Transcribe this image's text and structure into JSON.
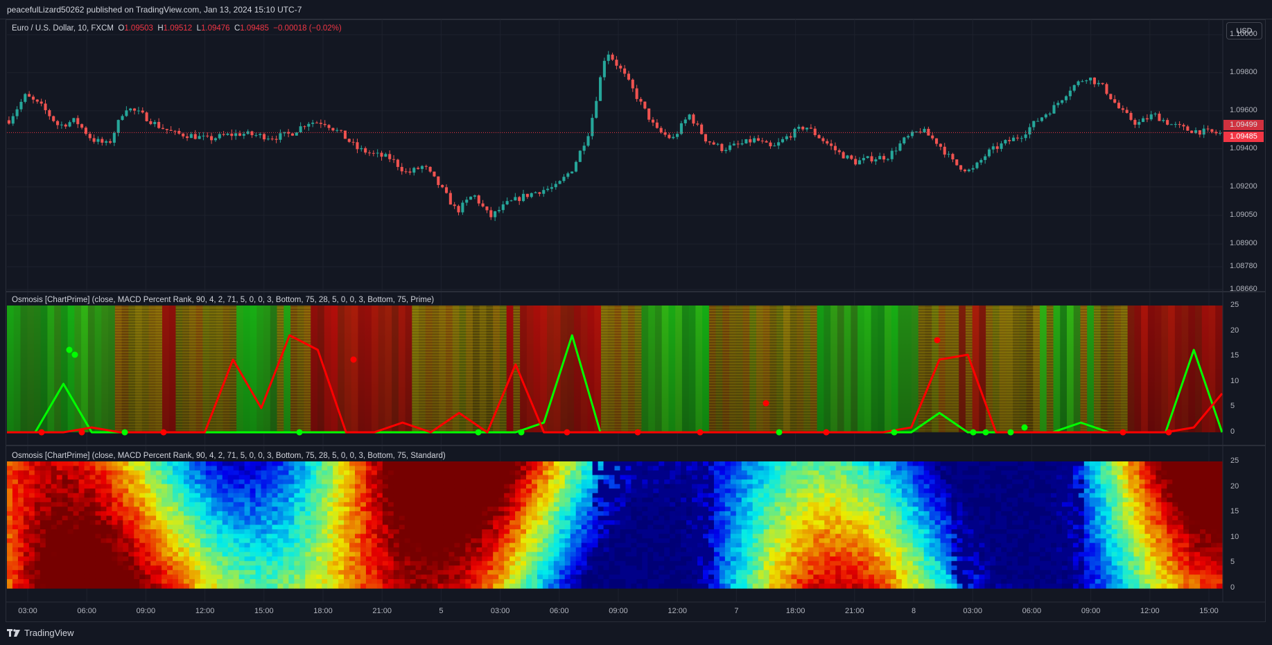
{
  "header": {
    "published": "peacefulLizard50262 published on TradingView.com, Jan 13, 2024 15:10 UTC-7"
  },
  "price_legend": {
    "symbol": "Euro / U.S. Dollar, 10, FXCM",
    "o_label": "O",
    "o": "1.09503",
    "h_label": "H",
    "h": "1.09512",
    "l_label": "L",
    "l": "1.09476",
    "c_label": "C",
    "c": "1.09485",
    "change": "−0.00018 (−0.02%)"
  },
  "currency_button": "USD",
  "price_axis": {
    "labels": [
      "1.10000",
      "1.09800",
      "1.09600",
      "1.09400",
      "1.09200",
      "1.09050",
      "1.08900",
      "1.08780",
      "1.08660"
    ],
    "tag_prev": "1.09499",
    "tag_last": "1.09485"
  },
  "indicator1": {
    "title": "Osmosis [ChartPrime] (close, MACD Percent Rank, 90, 4, 2, 71, 5, 0, 0, 3, Bottom, 75, 28, 5, 0, 0, 3, Bottom, 75, Prime)"
  },
  "indicator2": {
    "title": "Osmosis [ChartPrime] (close, MACD Percent Rank, 90, 4, 2, 71, 5, 0, 0, 3, Bottom, 75, 28, 5, 0, 0, 3, Bottom, 75, Standard)"
  },
  "osc_axis": {
    "labels": [
      "25",
      "20",
      "15",
      "10",
      "5",
      "0"
    ]
  },
  "time_axis": {
    "labels": [
      "03:00",
      "06:00",
      "09:00",
      "12:00",
      "15:00",
      "18:00",
      "21:00",
      "5",
      "03:00",
      "06:00",
      "09:00",
      "12:00",
      "7",
      "18:00",
      "21:00",
      "8",
      "03:00",
      "06:00",
      "09:00",
      "12:00",
      "15:00"
    ]
  },
  "footer": {
    "brand": "TradingView"
  },
  "colors": {
    "bg": "#131722",
    "up": "#26a69a",
    "down": "#ef5350",
    "green_line": "#00ff00",
    "red_line": "#ff0000",
    "tag": "#f23645"
  },
  "chart_data": [
    {
      "type": "candlestick",
      "symbol": "EURUSD",
      "interval": "10",
      "ylim": [
        1.0866,
        1.1
      ],
      "close_path": [
        1.0955,
        1.0968,
        1.0962,
        1.0952,
        1.0955,
        1.0945,
        1.0942,
        1.0962,
        1.0958,
        1.0952,
        1.0948,
        1.0947,
        1.0945,
        1.0947,
        1.0948,
        1.0947,
        1.0946,
        1.0948,
        1.0954,
        1.0954,
        1.0948,
        1.094,
        1.0937,
        1.0935,
        1.0927,
        1.0931,
        1.092,
        1.0907,
        1.0916,
        1.0904,
        1.0911,
        1.0915,
        1.0918,
        1.092,
        1.093,
        1.095,
        1.0992,
        1.098,
        1.0965,
        1.095,
        1.0945,
        1.0958,
        1.0945,
        1.094,
        1.0942,
        1.0945,
        1.094,
        1.0947,
        1.0952,
        1.0945,
        1.0938,
        1.0933,
        1.0935,
        1.0936,
        1.0945,
        1.095,
        1.0943,
        1.0932,
        1.0928,
        1.0938,
        1.0943,
        1.0947,
        1.0955,
        1.0962,
        1.0972,
        1.0978,
        1.0972,
        1.096,
        1.0953,
        1.0958,
        1.0953,
        1.095,
        1.0949,
        1.0948
      ]
    },
    {
      "type": "heatmap",
      "name": "Osmosis Prime",
      "ylim": [
        0,
        25
      ],
      "green_line": [
        0,
        0,
        10,
        0,
        0,
        0,
        0,
        0,
        0,
        0,
        0,
        0,
        0,
        0,
        0,
        0,
        0,
        0,
        0,
        2,
        20,
        0,
        0,
        0,
        0,
        0,
        0,
        0,
        0,
        0,
        0,
        0,
        0,
        4,
        0,
        0,
        0,
        0,
        2,
        0,
        0,
        0,
        17,
        0
      ],
      "red_line": [
        0,
        0,
        0,
        1,
        0,
        0,
        0,
        0,
        15,
        5,
        20,
        17,
        0,
        0,
        2,
        0,
        4,
        0,
        14,
        0,
        0,
        0,
        0,
        0,
        0,
        0,
        0,
        0,
        0,
        0,
        0,
        0,
        1,
        15,
        16,
        0,
        0,
        0,
        0,
        0,
        0,
        0,
        1,
        8
      ]
    },
    {
      "type": "heatmap",
      "name": "Osmosis Standard",
      "ylim": [
        0,
        25
      ]
    }
  ]
}
